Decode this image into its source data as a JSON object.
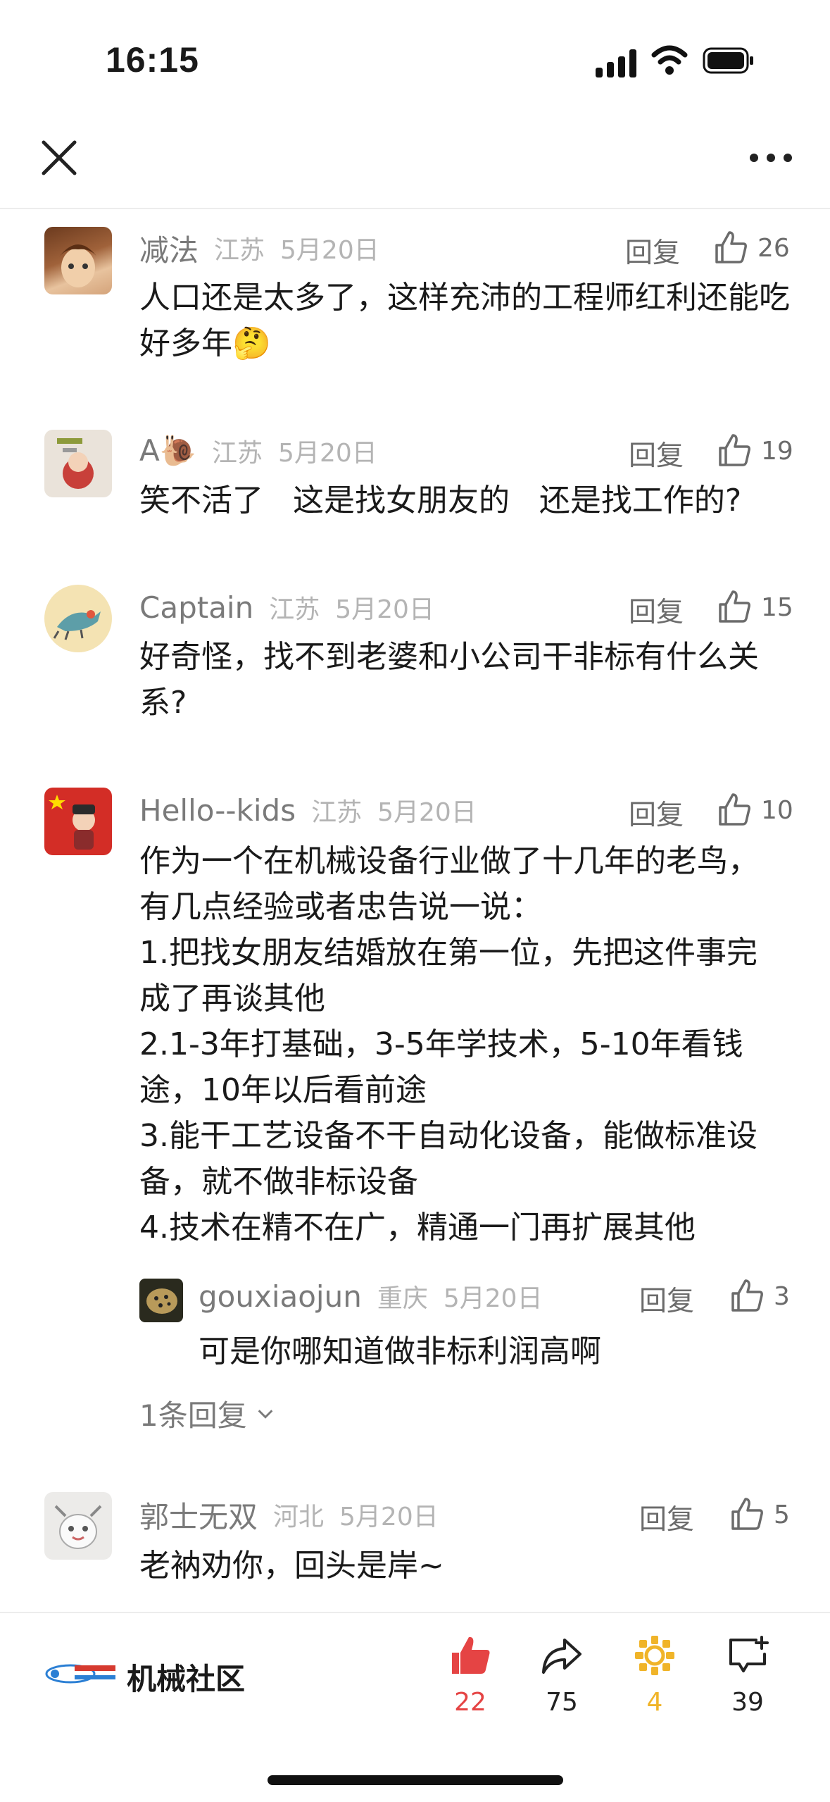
{
  "status_bar": {
    "time": "16:15"
  },
  "colors": {
    "like_active": "#e54444",
    "coin": "#f0b429",
    "muted": "#7a7a7a"
  },
  "comments": [
    {
      "name": "减法",
      "region": "江苏",
      "date": "5月20日",
      "reply": "回复",
      "likes": "26",
      "text": "人口还是太多了，这样充沛的工程师红利还能吃好多年🤔"
    },
    {
      "name": "A🐌",
      "region": "江苏",
      "date": "5月20日",
      "reply": "回复",
      "likes": "19",
      "text": "笑不活了   这是找女朋友的   还是找工作的?"
    },
    {
      "name": "Captain",
      "region": "江苏",
      "date": "5月20日",
      "reply": "回复",
      "likes": "15",
      "text": "好奇怪，找不到老婆和小公司干非标有什么关系?"
    },
    {
      "name": "Hello--kids",
      "region": "江苏",
      "date": "5月20日",
      "reply": "回复",
      "likes": "10",
      "text": "作为一个在机械设备行业做了十几年的老鸟，有几点经验或者忠告说一说：\n1.把找女朋友结婚放在第一位，先把这件事完成了再谈其他\n2.1-3年打基础，3-5年学技术，5-10年看钱途，10年以后看前途\n3.能干工艺设备不干自动化设备，能做标准设备，就不做非标设备\n4.技术在精不在广，精通一门再扩展其他",
      "sub_reply": {
        "name": "gouxiaojun",
        "region": "重庆",
        "date": "5月20日",
        "reply": "回复",
        "likes": "3",
        "text": "可是你哪知道做非标利润高啊"
      },
      "more_replies": "1条回复"
    },
    {
      "name": "郭士无双",
      "region": "河北",
      "date": "5月20日",
      "reply": "回复",
      "likes": "5",
      "text": "老衲劝你，回头是岸~"
    }
  ],
  "bottom_bar": {
    "brand_name": "机械社区",
    "like_count": "22",
    "share_count": "75",
    "coin_count": "4",
    "comment_count": "39"
  }
}
